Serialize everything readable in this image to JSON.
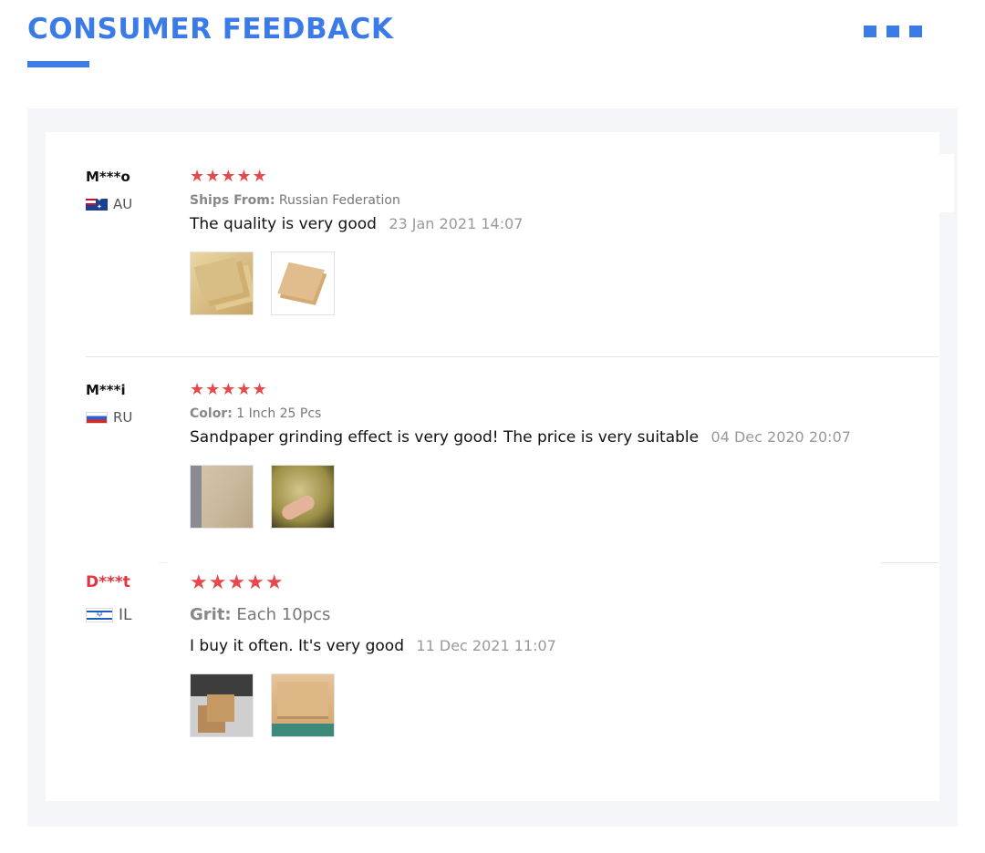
{
  "header": {
    "title": "CONSUMER FEEDBACK",
    "accent_color": "#3b7be8"
  },
  "reviews": [
    {
      "username": "M***o",
      "country": "AU",
      "flag_icon": "australia-flag-icon",
      "rating": 5,
      "stars": "★★★★★",
      "attribute_label": "Ships From:",
      "attribute_value": "Russian Federation",
      "text": "The quality is very good",
      "date": "23 Jan 2021 14:07",
      "photos": [
        "sandpaper-photo",
        "sandpaper-photo"
      ]
    },
    {
      "username": "M***i",
      "country": "RU",
      "flag_icon": "russia-flag-icon",
      "rating": 5,
      "stars": "★★★★★",
      "attribute_label": "Color:",
      "attribute_value": "1 Inch 25 Pcs",
      "text": "Sandpaper grinding effect is very good!  The price is very suitable",
      "date": "04 Dec 2020 20:07",
      "photos": [
        "sandpaper-photo",
        "sanded-item-photo"
      ]
    },
    {
      "username": "D***t",
      "country": "IL",
      "flag_icon": "israel-flag-icon",
      "rating": 5,
      "stars": "★★★★★",
      "attribute_label": "Grit:",
      "attribute_value": "Each 10pcs",
      "text": "I buy it often. It's very good",
      "date": "11 Dec 2021 11:07",
      "photos": [
        "package-photo",
        "package-photo"
      ]
    }
  ],
  "colors": {
    "star": "#e5494b",
    "highlight_username": "#e2353f",
    "panel_bg": "#f4f6fa"
  }
}
